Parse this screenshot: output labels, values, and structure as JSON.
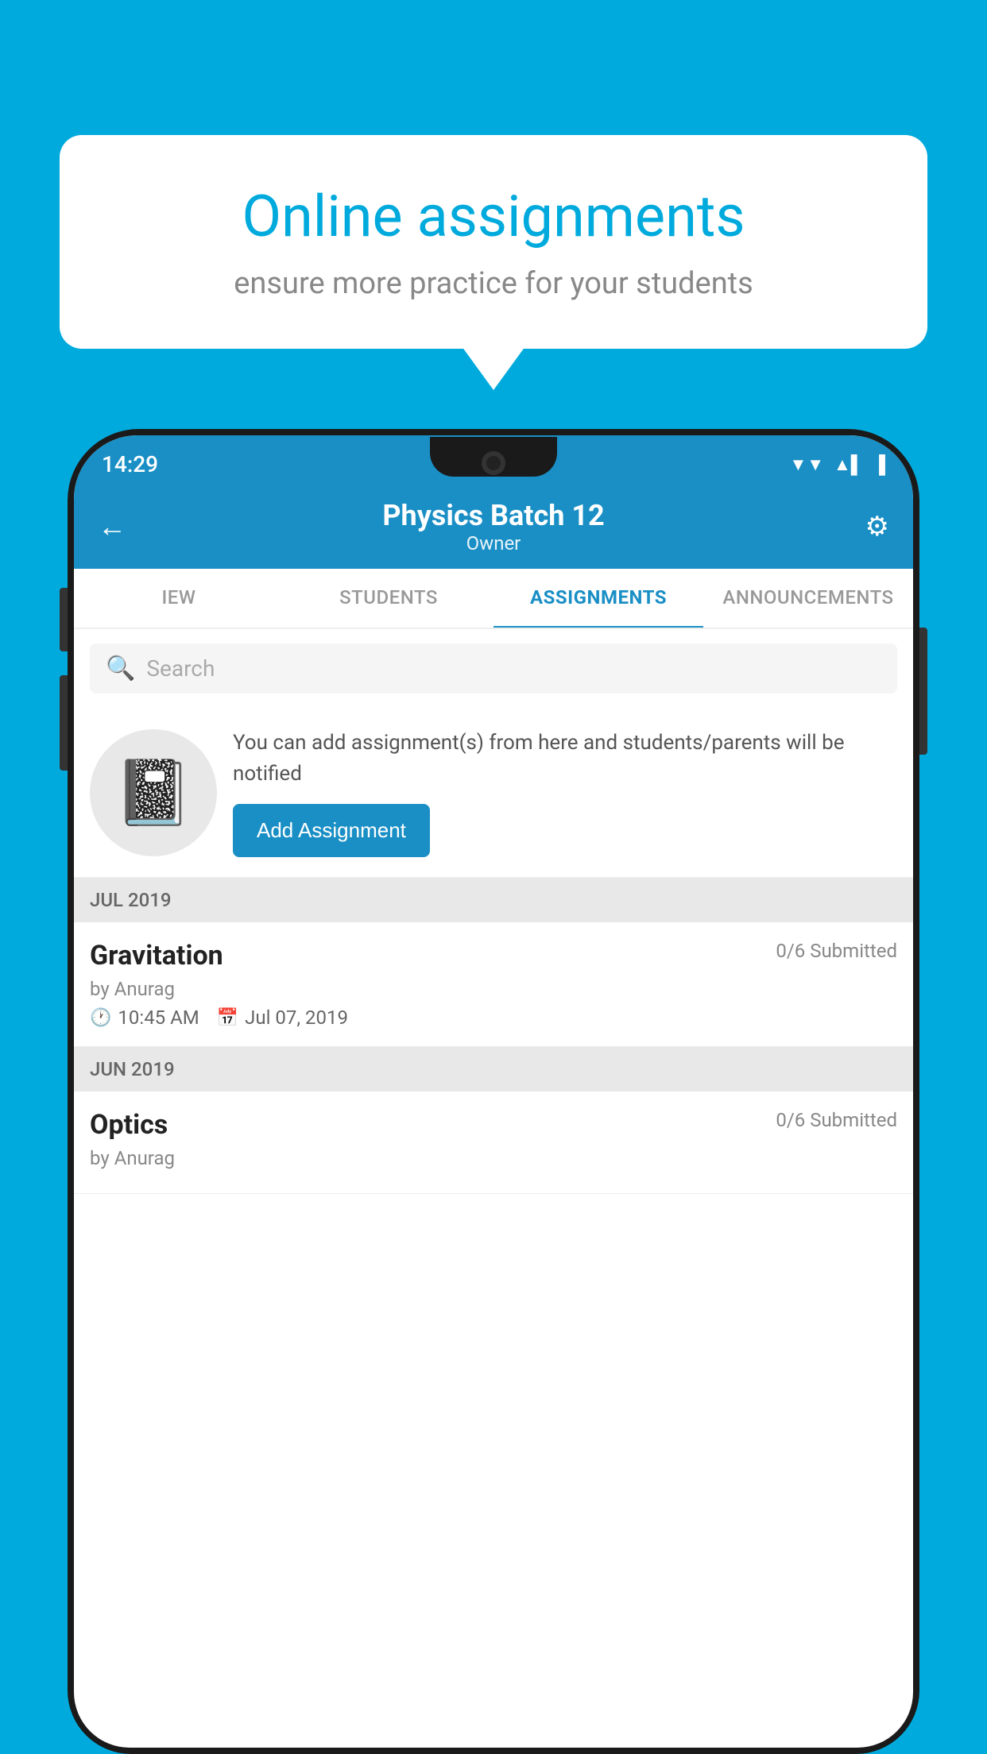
{
  "background": {
    "color": "#00AADD"
  },
  "speech_bubble": {
    "title": "Online assignments",
    "subtitle": "ensure more practice for your students"
  },
  "status_bar": {
    "time": "14:29",
    "wifi": "▲",
    "signal": "▲",
    "battery": "▌"
  },
  "header": {
    "title": "Physics Batch 12",
    "subtitle": "Owner",
    "back_label": "←",
    "settings_label": "⚙"
  },
  "tabs": [
    {
      "label": "IEW",
      "active": false
    },
    {
      "label": "STUDENTS",
      "active": false
    },
    {
      "label": "ASSIGNMENTS",
      "active": true
    },
    {
      "label": "ANNOUNCEMENTS",
      "active": false
    }
  ],
  "search": {
    "placeholder": "Search"
  },
  "add_assignment": {
    "description": "You can add assignment(s) from here and students/parents will be notified",
    "button_label": "Add Assignment"
  },
  "sections": [
    {
      "header": "JUL 2019",
      "assignments": [
        {
          "name": "Gravitation",
          "submitted": "0/6 Submitted",
          "by": "by Anurag",
          "time": "10:45 AM",
          "date": "Jul 07, 2019"
        }
      ]
    },
    {
      "header": "JUN 2019",
      "assignments": [
        {
          "name": "Optics",
          "submitted": "0/6 Submitted",
          "by": "by Anurag",
          "time": "",
          "date": ""
        }
      ]
    }
  ]
}
